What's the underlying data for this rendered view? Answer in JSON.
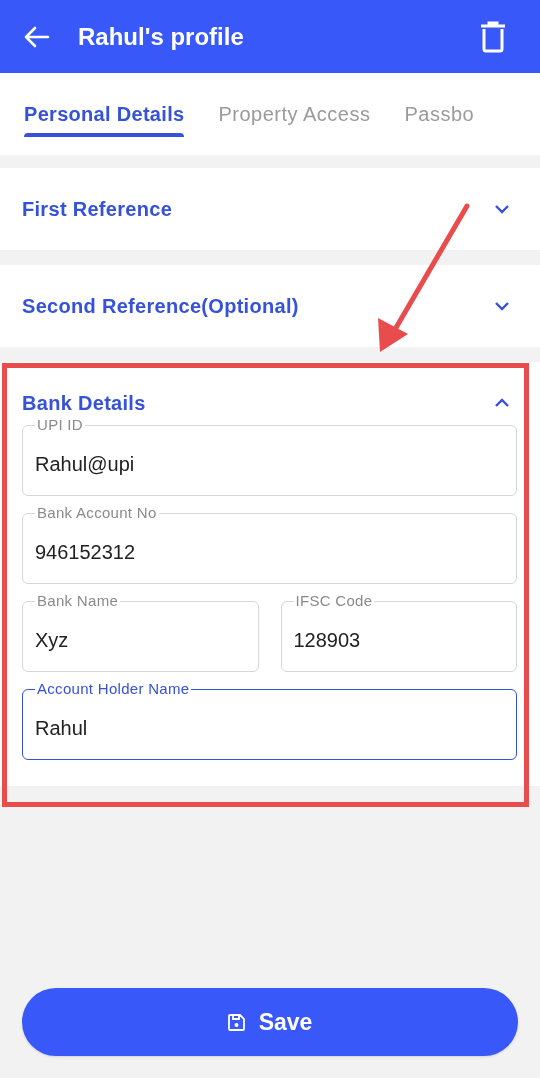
{
  "header": {
    "title": "Rahul's profile"
  },
  "tabs": [
    {
      "label": "Personal Details",
      "selected": true
    },
    {
      "label": "Property Access",
      "selected": false
    },
    {
      "label": "Passbo",
      "selected": false
    }
  ],
  "sections": [
    {
      "title": "First Reference",
      "expanded": false
    },
    {
      "title": "Second Reference(Optional)",
      "expanded": false
    },
    {
      "title": "Bank Details",
      "expanded": true,
      "field_rows": [
        [
          {
            "label": "UPI ID",
            "value": "Rahul@upi",
            "focused": false
          }
        ],
        [
          {
            "label": "Bank Account No",
            "value": "946152312",
            "focused": false
          }
        ],
        [
          {
            "label": "Bank Name",
            "value": "Xyz",
            "focused": false
          },
          {
            "label": "IFSC Code",
            "value": "128903",
            "focused": false
          }
        ],
        [
          {
            "label": "Account Holder Name",
            "value": "Rahul",
            "focused": true
          }
        ]
      ]
    }
  ],
  "save_button": {
    "label": "Save"
  }
}
